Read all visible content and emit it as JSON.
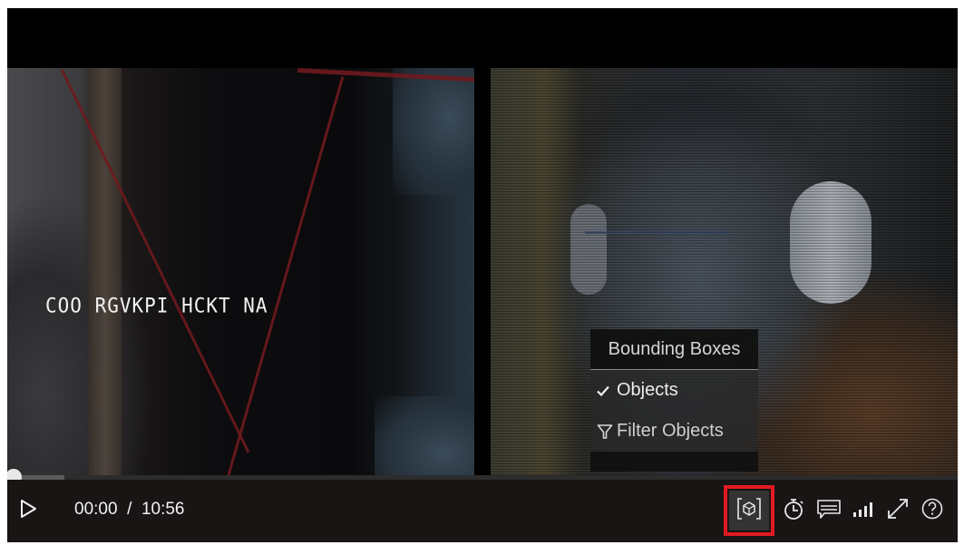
{
  "video": {
    "left_pane_overlay_text": "COO RGVKPI  HCKT NA"
  },
  "bounding_boxes_menu": {
    "title": "Bounding Boxes",
    "items": [
      {
        "label": "Objects",
        "icon": "checkmark-icon",
        "checked": true
      },
      {
        "label": "Filter Objects",
        "icon": "filter-icon",
        "checked": false
      }
    ]
  },
  "playback": {
    "current_time": "00:00",
    "separator": "/",
    "duration": "10:56",
    "progress_fraction": 0.0,
    "buffered_fraction": 0.06
  },
  "controls": {
    "play": {
      "icon": "play-icon",
      "label": "Play"
    },
    "right": [
      {
        "name": "bounding-boxes-button",
        "icon": "bounding-box-icon",
        "label": "Bounding Boxes",
        "active": true,
        "highlighted": true
      },
      {
        "name": "timer-button",
        "icon": "stopwatch-icon",
        "label": "Timer"
      },
      {
        "name": "captions-button",
        "icon": "captions-icon",
        "label": "Captions"
      },
      {
        "name": "quality-button",
        "icon": "signal-bars-icon",
        "label": "Quality"
      },
      {
        "name": "fullscreen-button",
        "icon": "expand-icon",
        "label": "Fullscreen"
      },
      {
        "name": "help-button",
        "icon": "help-icon",
        "label": "Help"
      }
    ]
  },
  "colors": {
    "highlight": "#e21a22",
    "control_bar": "#181514",
    "menu_bg": "#282828"
  }
}
